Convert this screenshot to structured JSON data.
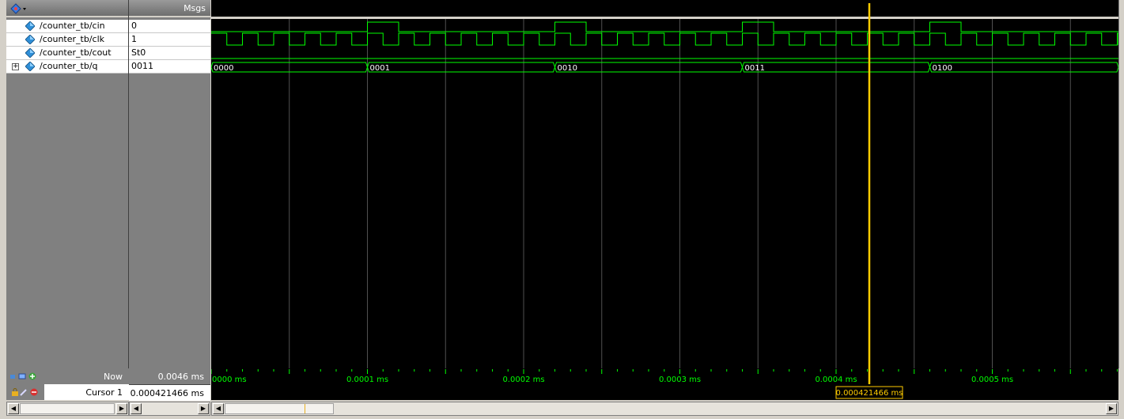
{
  "header": {
    "values_title": "Msgs"
  },
  "signals": [
    {
      "name": "/counter_tb/cin",
      "value": "0",
      "expandable": false
    },
    {
      "name": "/counter_tb/clk",
      "value": "1",
      "expandable": false
    },
    {
      "name": "/counter_tb/cout",
      "value": "St0",
      "expandable": false
    },
    {
      "name": "/counter_tb/q",
      "value": "0011",
      "expandable": true
    }
  ],
  "bus_values": [
    "0000",
    "0001",
    "0010",
    "0011",
    "0100"
  ],
  "bottom": {
    "now_label": "Now",
    "now_value": "0.0046 ms",
    "cursor_label": "Cursor 1",
    "cursor_value": "0.000421466 ms",
    "cursor_readout": "0.000421466 ms"
  },
  "timeline": {
    "ticks": [
      "0000 ms",
      "0.0001 ms",
      "0.0002 ms",
      "0.0003 ms",
      "0.0004 ms",
      "0.0005 ms"
    ]
  },
  "colors": {
    "wave": "#00ff00",
    "cursor": "#ffcc00",
    "grid": "#505050",
    "background": "#000000"
  },
  "icons": {
    "signal": "blue-diamond-icon",
    "expand": "plus-icon"
  }
}
